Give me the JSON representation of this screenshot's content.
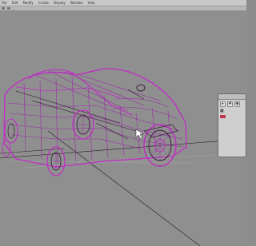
{
  "menubar": {
    "items": [
      "File",
      "Edit",
      "Modify",
      "Create",
      "Display",
      "Window",
      "Help"
    ]
  },
  "pathbar": {
    "path": "..."
  },
  "context_window": {
    "toolbar_icons": [
      "select-icon",
      "move-icon",
      "render-icon"
    ],
    "row1_label": "",
    "row2_label": ""
  },
  "colors": {
    "background": "#8f8f8f",
    "wireframe": "#c22bc7",
    "window_bg": "#cfcfcf",
    "material_swatch": "#c0394b"
  }
}
